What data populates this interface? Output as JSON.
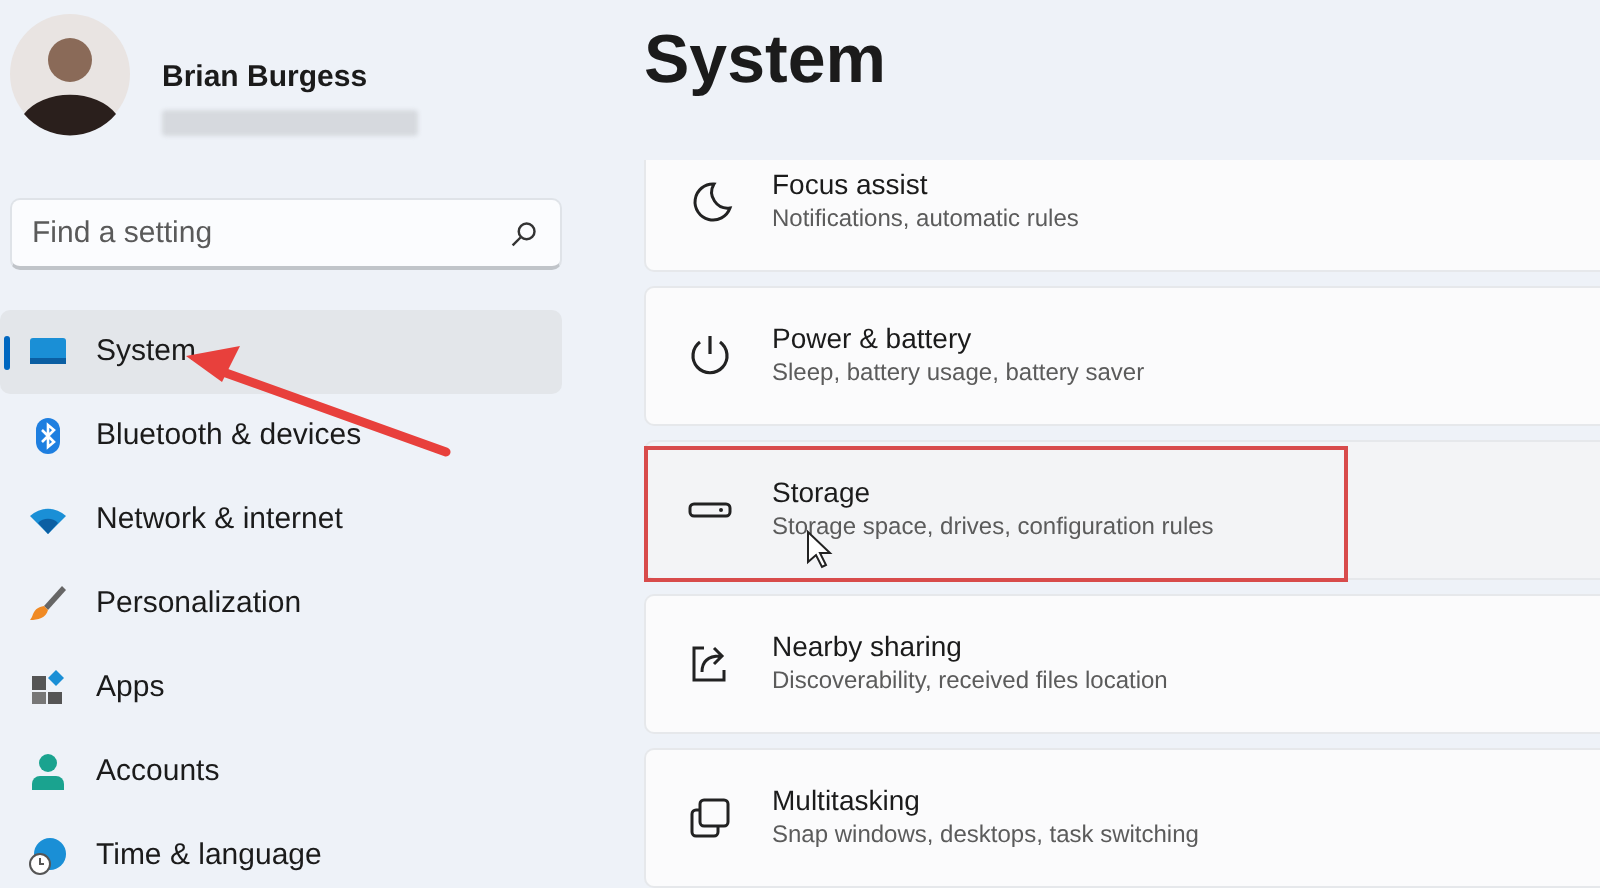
{
  "account": {
    "name": "Brian Burgess",
    "email_hidden": true
  },
  "search": {
    "placeholder": "Find a setting"
  },
  "sidebar": {
    "items": [
      {
        "label": "System",
        "selected": true,
        "pointed_at": true
      },
      {
        "label": "Bluetooth & devices",
        "selected": false,
        "pointed_at": false
      },
      {
        "label": "Network & internet",
        "selected": false,
        "pointed_at": false
      },
      {
        "label": "Personalization",
        "selected": false,
        "pointed_at": false
      },
      {
        "label": "Apps",
        "selected": false,
        "pointed_at": false
      },
      {
        "label": "Accounts",
        "selected": false,
        "pointed_at": false
      },
      {
        "label": "Time & language",
        "selected": false,
        "pointed_at": false
      }
    ]
  },
  "page": {
    "title": "System",
    "items": [
      {
        "title": "Focus assist",
        "subtitle": "Notifications, automatic rules",
        "hovered": false,
        "framed": false
      },
      {
        "title": "Power & battery",
        "subtitle": "Sleep, battery usage, battery saver",
        "hovered": false,
        "framed": false
      },
      {
        "title": "Storage",
        "subtitle": "Storage space, drives, configuration rules",
        "hovered": true,
        "framed": true
      },
      {
        "title": "Nearby sharing",
        "subtitle": "Discoverability, received files location",
        "hovered": false,
        "framed": false
      },
      {
        "title": "Multitasking",
        "subtitle": "Snap windows, desktops, task switching",
        "hovered": false,
        "framed": false
      }
    ]
  }
}
